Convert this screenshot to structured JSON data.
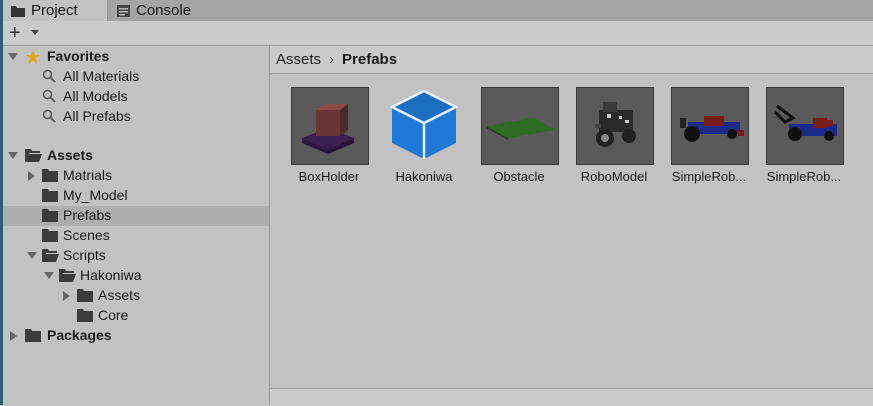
{
  "tabs": [
    {
      "label": "Project",
      "icon": "folder-icon",
      "active": true
    },
    {
      "label": "Console",
      "icon": "console-icon",
      "active": false
    }
  ],
  "toolbar": {
    "create_label": "+"
  },
  "tree": {
    "favorites": {
      "label": "Favorites",
      "items": [
        "All Materials",
        "All Models",
        "All Prefabs"
      ]
    },
    "assets": {
      "label": "Assets",
      "items": [
        "Matrials",
        "My_Model",
        "Prefabs",
        "Scenes",
        "Scripts"
      ],
      "scripts_children": [
        "Hakoniwa"
      ],
      "hakoniwa_children": [
        "Assets",
        "Core"
      ]
    },
    "packages": {
      "label": "Packages"
    }
  },
  "breadcrumb": [
    "Assets",
    "Prefabs"
  ],
  "assets_grid": [
    {
      "label": "BoxHolder"
    },
    {
      "label": "Hakoniwa"
    },
    {
      "label": "Obstacle"
    },
    {
      "label": "RoboModel"
    },
    {
      "label": "SimpleRob..."
    },
    {
      "label": "SimpleRob..."
    }
  ],
  "colors": {
    "selection": "#aeaeae",
    "accent_blue": "#1e7ad6",
    "star": "#e2a41d"
  }
}
